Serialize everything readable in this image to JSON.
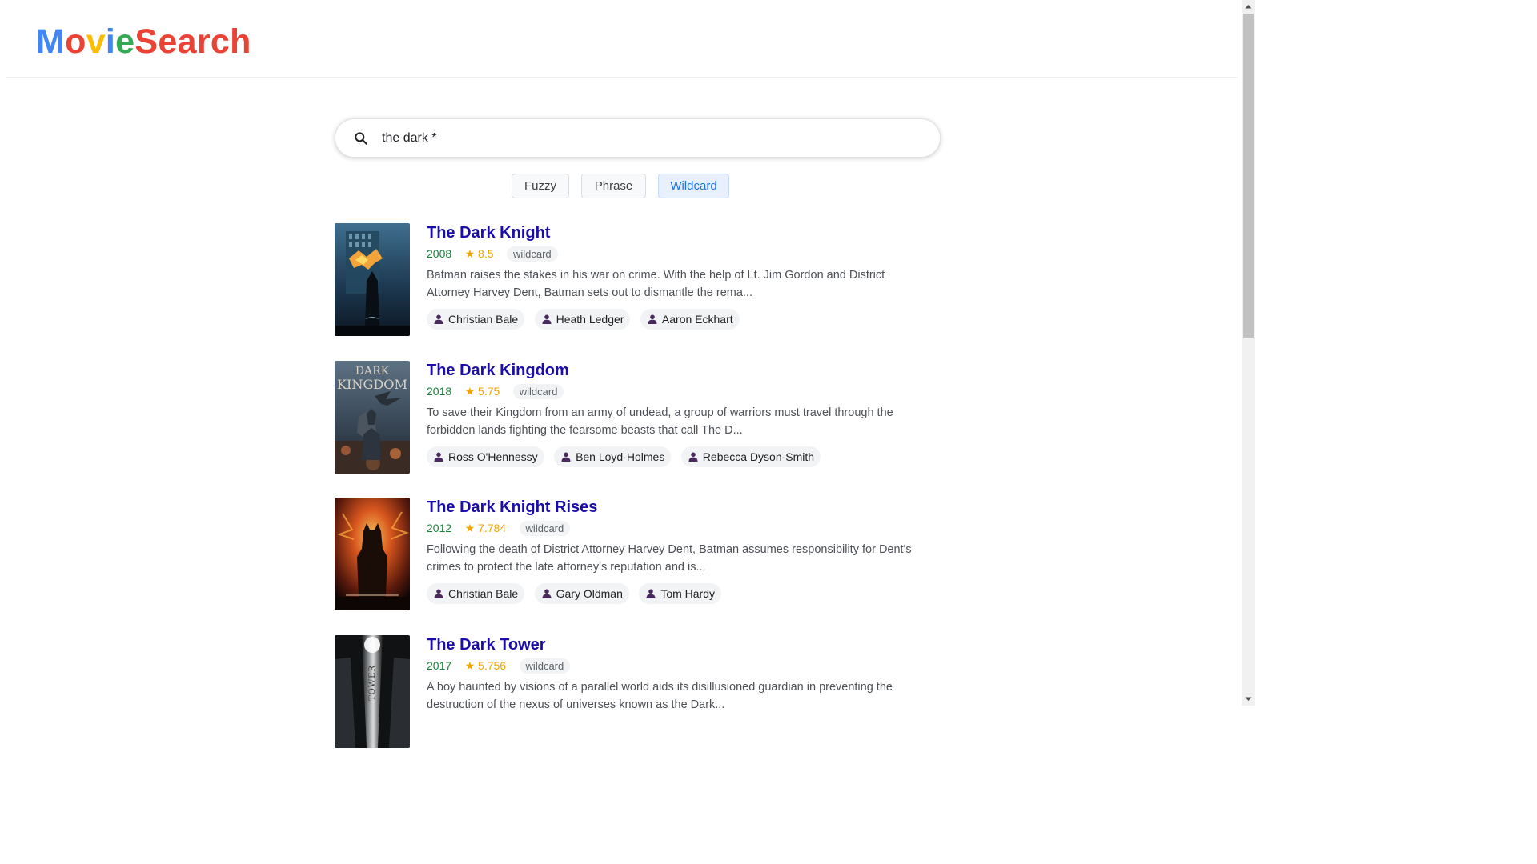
{
  "app": {
    "logo_letters": [
      {
        "char": "M",
        "color": "#4285f4"
      },
      {
        "char": "o",
        "color": "#ea4335"
      },
      {
        "char": "v",
        "color": "#fbbc05"
      },
      {
        "char": "i",
        "color": "#4285f4"
      },
      {
        "char": "e",
        "color": "#34a853"
      },
      {
        "char": "S",
        "color": "#ea4335"
      },
      {
        "char": "e",
        "color": "#ea4335"
      },
      {
        "char": "a",
        "color": "#ea4335"
      },
      {
        "char": "r",
        "color": "#ea4335"
      },
      {
        "char": "c",
        "color": "#ea4335"
      },
      {
        "char": "h",
        "color": "#ea4335"
      }
    ]
  },
  "search": {
    "value": "the dark *",
    "icon": "search-icon"
  },
  "modes": [
    {
      "label": "Fuzzy",
      "active": false
    },
    {
      "label": "Phrase",
      "active": false
    },
    {
      "label": "Wildcard",
      "active": true
    }
  ],
  "results": [
    {
      "title": "The Dark Knight",
      "year": "2008",
      "rating": "★ 8.5",
      "tag": "wildcard",
      "description": "Batman raises the stakes in his war on crime. With the help of Lt. Jim Gordon and District Attorney Harvey Dent, Batman sets out to dismantle the rema...",
      "cast": [
        "Christian Bale",
        "Heath Ledger",
        "Aaron Eckhart"
      ]
    },
    {
      "title": "The Dark Kingdom",
      "year": "2018",
      "rating": "★ 5.75",
      "tag": "wildcard",
      "description": "To save their Kingdom from an army of undead, a group of warriors must travel through the forbidden lands fighting the fearsome beasts that call The D...",
      "cast": [
        "Ross O'Hennessy",
        "Ben Loyd-Holmes",
        "Rebecca Dyson-Smith"
      ],
      "poster_text": [
        "DARK",
        "KINGDOM"
      ]
    },
    {
      "title": "The Dark Knight Rises",
      "year": "2012",
      "rating": "★ 7.784",
      "tag": "wildcard",
      "description": "Following the death of District Attorney Harvey Dent, Batman assumes responsibility for Dent's crimes to protect the late attorney's reputation and is...",
      "cast": [
        "Christian Bale",
        "Gary Oldman",
        "Tom Hardy"
      ]
    },
    {
      "title": "The Dark Tower",
      "year": "2017",
      "rating": "★ 5.756",
      "tag": "wildcard",
      "description": "A boy haunted by visions of a parallel world aids its disillusioned guardian in preventing the destruction of the nexus of universes known as the Dark...",
      "cast": [],
      "poster_text": [
        "TOWER"
      ]
    }
  ],
  "colors": {
    "title": "#1a0dab",
    "year": "#188038",
    "rating": "#f4a300",
    "active_mode": "#1a73e8"
  }
}
